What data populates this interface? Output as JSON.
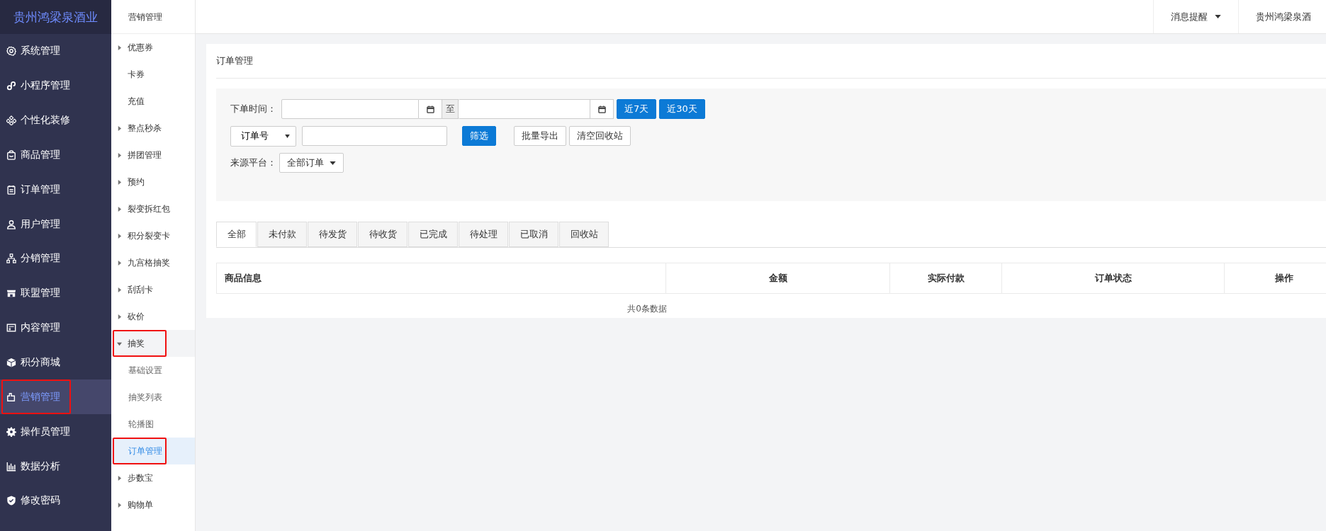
{
  "sidebar": {
    "logo": "贵州鸿梁泉酒业",
    "items": [
      {
        "label": "系统管理",
        "selected": false,
        "highlighted": false
      },
      {
        "label": "小程序管理",
        "selected": false,
        "highlighted": false
      },
      {
        "label": "个性化装修",
        "selected": false,
        "highlighted": false
      },
      {
        "label": "商品管理",
        "selected": false,
        "highlighted": false
      },
      {
        "label": "订单管理",
        "selected": false,
        "highlighted": false
      },
      {
        "label": "用户管理",
        "selected": false,
        "highlighted": false
      },
      {
        "label": "分销管理",
        "selected": false,
        "highlighted": false
      },
      {
        "label": "联盟管理",
        "selected": false,
        "highlighted": false
      },
      {
        "label": "内容管理",
        "selected": false,
        "highlighted": false
      },
      {
        "label": "积分商城",
        "selected": false,
        "highlighted": false
      },
      {
        "label": "营销管理",
        "selected": true,
        "highlighted": true
      },
      {
        "label": "操作员管理",
        "selected": false,
        "highlighted": false
      },
      {
        "label": "数据分析",
        "selected": false,
        "highlighted": false
      },
      {
        "label": "修改密码",
        "selected": false,
        "highlighted": false
      }
    ]
  },
  "subnav": {
    "title": "营销管理",
    "items": [
      {
        "label": "优惠券",
        "expanded": false,
        "selected": false,
        "highlighted": false
      },
      {
        "label": "卡券",
        "selected": false,
        "highlighted": false
      },
      {
        "label": "充值",
        "selected": false,
        "highlighted": false
      },
      {
        "label": "整点秒杀",
        "expanded": false,
        "selected": false,
        "highlighted": false
      },
      {
        "label": "拼团管理",
        "expanded": false,
        "selected": false,
        "highlighted": false
      },
      {
        "label": "预约",
        "expanded": false,
        "selected": false,
        "highlighted": false
      },
      {
        "label": "裂变拆红包",
        "expanded": false,
        "selected": false,
        "highlighted": false
      },
      {
        "label": "积分裂变卡",
        "expanded": false,
        "selected": false,
        "highlighted": false
      },
      {
        "label": "九宫格抽奖",
        "expanded": false,
        "selected": false,
        "highlighted": false
      },
      {
        "label": "刮刮卡",
        "expanded": false,
        "selected": false,
        "highlighted": false
      },
      {
        "label": "砍价",
        "expanded": false,
        "selected": false,
        "highlighted": false
      },
      {
        "label": "抽奖",
        "expanded": true,
        "selected": false,
        "highlighted": true,
        "children": [
          {
            "label": "基础设置",
            "selected": false,
            "highlighted": false
          },
          {
            "label": "抽奖列表",
            "selected": false,
            "highlighted": false
          },
          {
            "label": "轮播图",
            "selected": false,
            "highlighted": false
          },
          {
            "label": "订单管理",
            "selected": true,
            "highlighted": true
          }
        ]
      },
      {
        "label": "步数宝",
        "expanded": false,
        "selected": false,
        "highlighted": false
      },
      {
        "label": "购物单",
        "expanded": false,
        "selected": false,
        "highlighted": false
      }
    ]
  },
  "topbar": {
    "notifications": "消息提醒",
    "account": "贵州鸿梁泉酒"
  },
  "panel": {
    "title": "订单管理",
    "filters": {
      "date_label": "下单时间：",
      "date_separator": "至",
      "quick_buttons": [
        "近7天",
        "近30天"
      ],
      "search_type": "订单号",
      "filter_button": "筛选",
      "actions": [
        "批量导出",
        "清空回收站"
      ],
      "source_label": "来源平台：",
      "source_value": "全部订单"
    },
    "tabs": [
      {
        "label": "全部",
        "selected": true
      },
      {
        "label": "未付款",
        "selected": false
      },
      {
        "label": "待发货",
        "selected": false
      },
      {
        "label": "待收货",
        "selected": false
      },
      {
        "label": "已完成",
        "selected": false
      },
      {
        "label": "待处理",
        "selected": false
      },
      {
        "label": "已取消",
        "selected": false
      },
      {
        "label": "回收站",
        "selected": false
      }
    ],
    "table": {
      "columns": [
        "商品信息",
        "金额",
        "实际付款",
        "订单状态",
        "操作"
      ],
      "footer": "共0条数据"
    }
  }
}
